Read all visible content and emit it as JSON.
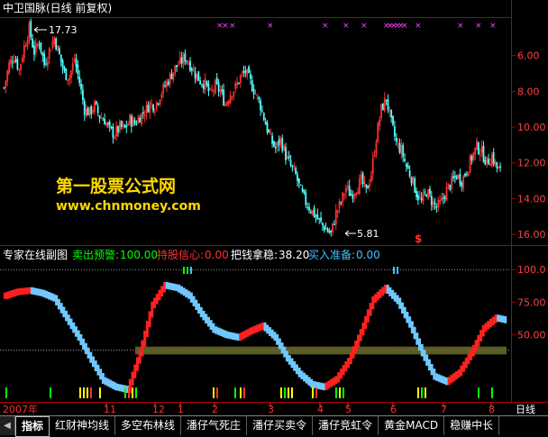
{
  "chart_header": {
    "title": "中卫国脉(日线 前复权)"
  },
  "price_pane": {
    "y_ticks": [
      "16.00",
      "14.00",
      "12.00",
      "10.00",
      "8.00",
      "6.00"
    ],
    "high_label": "17.73",
    "low_label": "5.81",
    "signal_marker": "$"
  },
  "indicator_pane": {
    "name": "专家在线副图",
    "fields": [
      {
        "label": "卖出预警",
        "value": "100.00",
        "color": "#00ff00"
      },
      {
        "label": "持股信心",
        "value": "0.00",
        "color": "#ff3030"
      },
      {
        "label": "把钱拿稳",
        "value": "38.20",
        "color": "#ffffff"
      },
      {
        "label": "买入准备",
        "value": "0.00",
        "color": "#40c0ff"
      }
    ],
    "y_ticks": [
      "100.0",
      "75.00",
      "50.00"
    ]
  },
  "date_axis": {
    "year_label": "2007年",
    "months": [
      "11",
      "12",
      "1",
      "2",
      "3",
      "4",
      "5",
      "6",
      "7",
      "8"
    ],
    "period": "日线"
  },
  "watermark": {
    "line1": "第一股票公式网",
    "line2": "www.chnmoney.com"
  },
  "tabs": [
    "指标",
    "红财神均线",
    "多空布林线",
    "潘仔气死庄",
    "潘仔买卖令",
    "潘仔竞虹令",
    "黄金MACD",
    "稳赚中长"
  ],
  "chart_data": {
    "type": "candlestick",
    "title": "中卫国脉(日线 前复权)",
    "ylim": [
      5.5,
      18
    ],
    "high": 17.73,
    "low": 5.81,
    "y_ticks": [
      6,
      8,
      10,
      12,
      14,
      16
    ],
    "x_ticks": [
      "2007年",
      "11",
      "12",
      "1",
      "2",
      "3",
      "4",
      "5",
      "6",
      "7",
      "8"
    ],
    "price_path": [
      [
        0,
        14.2
      ],
      [
        3,
        15.5
      ],
      [
        6,
        16.0
      ],
      [
        9,
        15.2
      ],
      [
        12,
        16.5
      ],
      [
        15,
        17.5
      ],
      [
        18,
        16.2
      ],
      [
        21,
        16.8
      ],
      [
        24,
        15.5
      ],
      [
        27,
        16.3
      ],
      [
        30,
        17.0
      ],
      [
        33,
        16.0
      ],
      [
        36,
        15.0
      ],
      [
        39,
        14.8
      ],
      [
        42,
        15.8
      ],
      [
        45,
        14.5
      ],
      [
        48,
        13.0
      ],
      [
        51,
        12.8
      ],
      [
        54,
        13.2
      ],
      [
        57,
        12.6
      ],
      [
        60,
        12.4
      ],
      [
        63,
        11.8
      ],
      [
        66,
        11.6
      ],
      [
        69,
        12.0
      ],
      [
        72,
        11.9
      ],
      [
        75,
        12.4
      ],
      [
        78,
        12.2
      ],
      [
        81,
        12.6
      ],
      [
        84,
        12.9
      ],
      [
        87,
        13.3
      ],
      [
        90,
        13.2
      ],
      [
        93,
        13.8
      ],
      [
        96,
        14.3
      ],
      [
        99,
        14.8
      ],
      [
        102,
        15.3
      ],
      [
        105,
        15.6
      ],
      [
        108,
        15.9
      ],
      [
        111,
        15.5
      ],
      [
        114,
        15.0
      ],
      [
        117,
        14.6
      ],
      [
        120,
        14.4
      ],
      [
        123,
        13.8
      ],
      [
        126,
        14.3
      ],
      [
        129,
        14.0
      ],
      [
        132,
        13.3
      ],
      [
        135,
        13.9
      ],
      [
        138,
        14.2
      ],
      [
        141,
        14.8
      ],
      [
        144,
        15.1
      ],
      [
        147,
        14.5
      ],
      [
        150,
        13.9
      ],
      [
        153,
        13.2
      ],
      [
        156,
        12.2
      ],
      [
        159,
        11.3
      ],
      [
        162,
        10.8
      ],
      [
        165,
        11.3
      ],
      [
        168,
        10.4
      ],
      [
        171,
        9.8
      ],
      [
        174,
        9.3
      ],
      [
        177,
        8.4
      ],
      [
        180,
        7.8
      ],
      [
        183,
        7.4
      ],
      [
        186,
        7.0
      ],
      [
        189,
        6.6
      ],
      [
        192,
        6.3
      ],
      [
        195,
        6.0
      ],
      [
        198,
        7.2
      ],
      [
        201,
        7.8
      ],
      [
        204,
        8.6
      ],
      [
        207,
        8.2
      ],
      [
        210,
        8.6
      ],
      [
        213,
        9.0
      ],
      [
        216,
        8.4
      ],
      [
        219,
        9.4
      ],
      [
        222,
        11.4
      ],
      [
        225,
        13.0
      ],
      [
        228,
        13.6
      ],
      [
        231,
        12.2
      ],
      [
        234,
        11.1
      ],
      [
        237,
        10.7
      ],
      [
        240,
        9.8
      ],
      [
        243,
        9.2
      ],
      [
        246,
        8.3
      ],
      [
        249,
        7.8
      ],
      [
        252,
        8.4
      ],
      [
        255,
        7.9
      ],
      [
        258,
        7.5
      ],
      [
        261,
        7.8
      ],
      [
        264,
        8.5
      ],
      [
        267,
        8.9
      ],
      [
        270,
        9.3
      ],
      [
        273,
        9.0
      ],
      [
        276,
        9.6
      ],
      [
        279,
        10.3
      ],
      [
        282,
        10.9
      ],
      [
        285,
        10.6
      ],
      [
        288,
        10.0
      ],
      [
        291,
        10.4
      ],
      [
        294,
        9.7
      ],
      [
        297,
        9.4
      ]
    ],
    "sub_pane": {
      "name": "专家在线副图",
      "ylim": [
        0,
        105
      ],
      "y_ticks": [
        50,
        75,
        100
      ],
      "reference_line": 38.2,
      "oscillator": [
        [
          0,
          80
        ],
        [
          10,
          83
        ],
        [
          20,
          84
        ],
        [
          30,
          82
        ],
        [
          40,
          78
        ],
        [
          50,
          63
        ],
        [
          60,
          48
        ],
        [
          70,
          31
        ],
        [
          80,
          15
        ],
        [
          90,
          10
        ],
        [
          100,
          8
        ],
        [
          110,
          36
        ],
        [
          120,
          73
        ],
        [
          130,
          88
        ],
        [
          140,
          86
        ],
        [
          150,
          80
        ],
        [
          160,
          66
        ],
        [
          170,
          54
        ],
        [
          180,
          50
        ],
        [
          190,
          48
        ],
        [
          200,
          53
        ],
        [
          210,
          57
        ],
        [
          220,
          48
        ],
        [
          230,
          32
        ],
        [
          240,
          20
        ],
        [
          250,
          12
        ],
        [
          260,
          10
        ],
        [
          270,
          16
        ],
        [
          280,
          30
        ],
        [
          290,
          52
        ],
        [
          300,
          77
        ],
        [
          310,
          86
        ],
        [
          320,
          76
        ],
        [
          330,
          58
        ],
        [
          340,
          36
        ],
        [
          350,
          18
        ],
        [
          360,
          14
        ],
        [
          370,
          21
        ],
        [
          380,
          36
        ],
        [
          390,
          55
        ],
        [
          400,
          63
        ],
        [
          410,
          61
        ]
      ]
    }
  }
}
